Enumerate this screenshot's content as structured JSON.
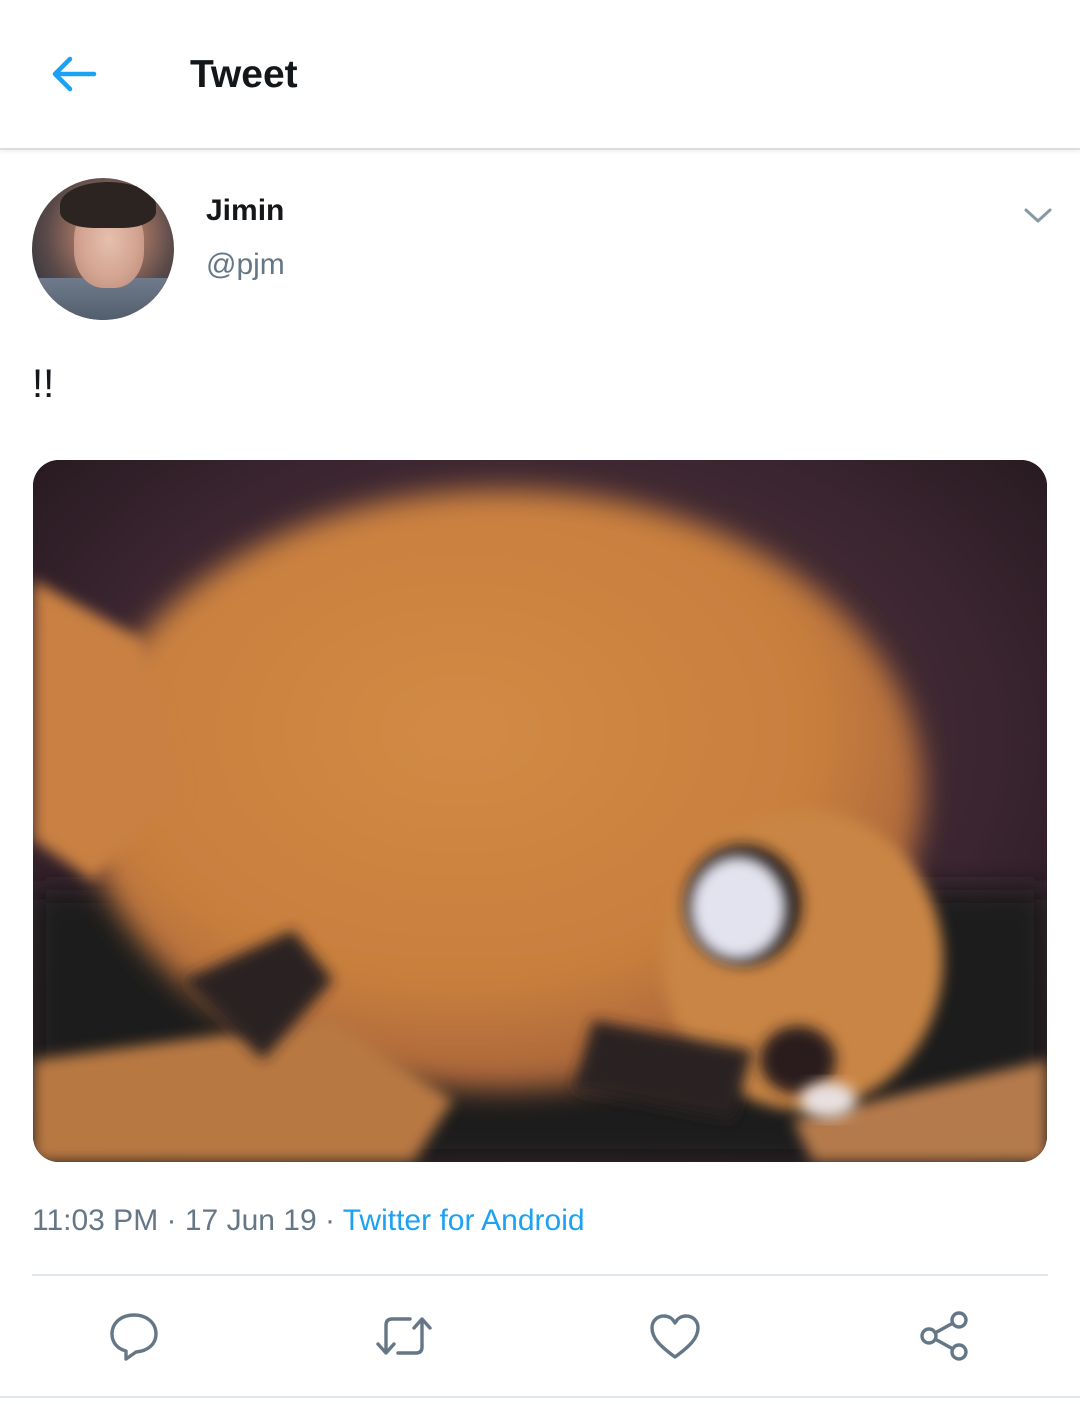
{
  "header": {
    "title": "Tweet",
    "back_icon": "arrow-left-icon"
  },
  "tweet": {
    "author": {
      "name": "Jimin",
      "handle": "@pjm"
    },
    "text": "!!",
    "meta": {
      "time": "11:03 PM",
      "separator": " · ",
      "date": "17 Jun 19",
      "source": "Twitter for Android"
    },
    "actions": [
      {
        "name": "reply",
        "icon": "reply-bubble-icon"
      },
      {
        "name": "retweet",
        "icon": "retweet-icon"
      },
      {
        "name": "like",
        "icon": "heart-icon"
      },
      {
        "name": "share",
        "icon": "share-icon"
      }
    ]
  },
  "colors": {
    "accent": "#1da1f2",
    "secondary_text": "#657786",
    "primary_text": "#14171a",
    "divider": "#e1e8ed"
  }
}
